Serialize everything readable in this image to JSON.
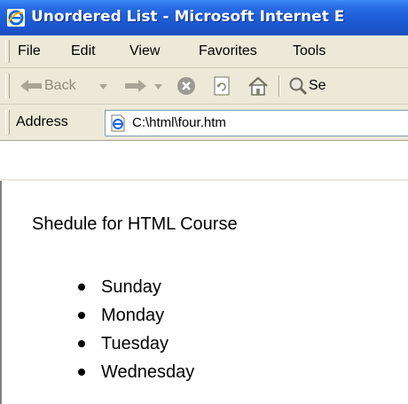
{
  "window": {
    "title": "Unordered List - Microsoft Internet E"
  },
  "menu": {
    "items": [
      "File",
      "Edit",
      "View",
      "Favorites",
      "Tools"
    ]
  },
  "toolbar": {
    "back_label": "Back",
    "search_label": "Se",
    "icons": [
      "back-arrow-icon",
      "forward-arrow-icon",
      "stop-icon",
      "refresh-icon",
      "home-icon",
      "search-icon"
    ]
  },
  "address": {
    "label": "Address",
    "value": "C:\\html\\four.htm"
  },
  "page": {
    "heading": "Shedule for HTML Course",
    "days": [
      "Sunday",
      "Monday",
      "Tuesday",
      "Wednesday"
    ]
  },
  "colors": {
    "titlebar": "#1f5fd8",
    "chrome": "#ece9d8",
    "content_bg": "#ffffff"
  }
}
